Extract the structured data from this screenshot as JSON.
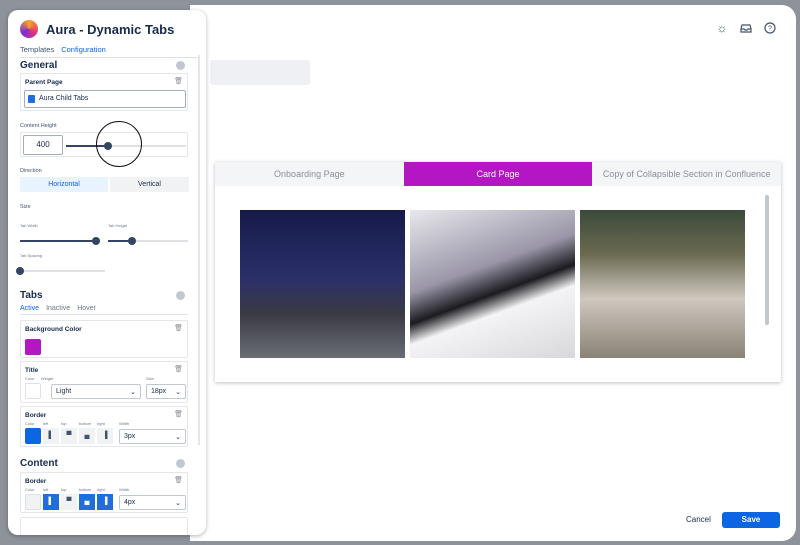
{
  "app": {
    "title": "Aura - Dynamic Tabs"
  },
  "side_tabs": [
    "Templates",
    "Configuration"
  ],
  "general": {
    "heading": "General",
    "parent_page_label": "Parent Page",
    "parent_page_value": "Aura Child Tabs",
    "content_height_label": "Content Height",
    "content_height_value": "400",
    "content_height_slider": 0.35,
    "direction_label": "Direction",
    "direction_options": [
      "Horizontal",
      "Vertical"
    ],
    "direction_selected": "Horizontal",
    "size_label": "Size",
    "tab_width_label": "Tab Width",
    "tab_width": 0.95,
    "tab_height_label": "Tab Height",
    "tab_height": 0.3,
    "tab_spacing_label": "Tab Spacing",
    "tab_spacing": 0.0
  },
  "tabs_section": {
    "heading": "Tabs",
    "states": [
      "Active",
      "Inactive",
      "Hover"
    ],
    "bg_label": "Background Color",
    "bg_color": "#b416c4",
    "title_label": "Title",
    "color_label": "Color",
    "weight_label": "Weight",
    "weight_value": "Light",
    "size_label": "Size",
    "size_value": "18px",
    "border_label": "Border",
    "sides": [
      "left",
      "top",
      "bottom",
      "right"
    ],
    "width_label": "Width",
    "border_width": "3px",
    "border_color": "#0c66e4"
  },
  "content_section": {
    "heading": "Content",
    "border_label": "Border",
    "color_label": "Color",
    "sides": [
      "left",
      "top",
      "bottom",
      "right"
    ],
    "width_label": "Width",
    "border_width": "4px"
  },
  "preview": {
    "tabs": [
      "Onboarding Page",
      "Card Page",
      "Copy of Collapsible Section in Confluence"
    ],
    "active": 1
  },
  "actions": {
    "cancel": "Cancel",
    "save": "Save"
  },
  "icons": [
    "sun-icon",
    "inbox-icon",
    "help-icon"
  ]
}
